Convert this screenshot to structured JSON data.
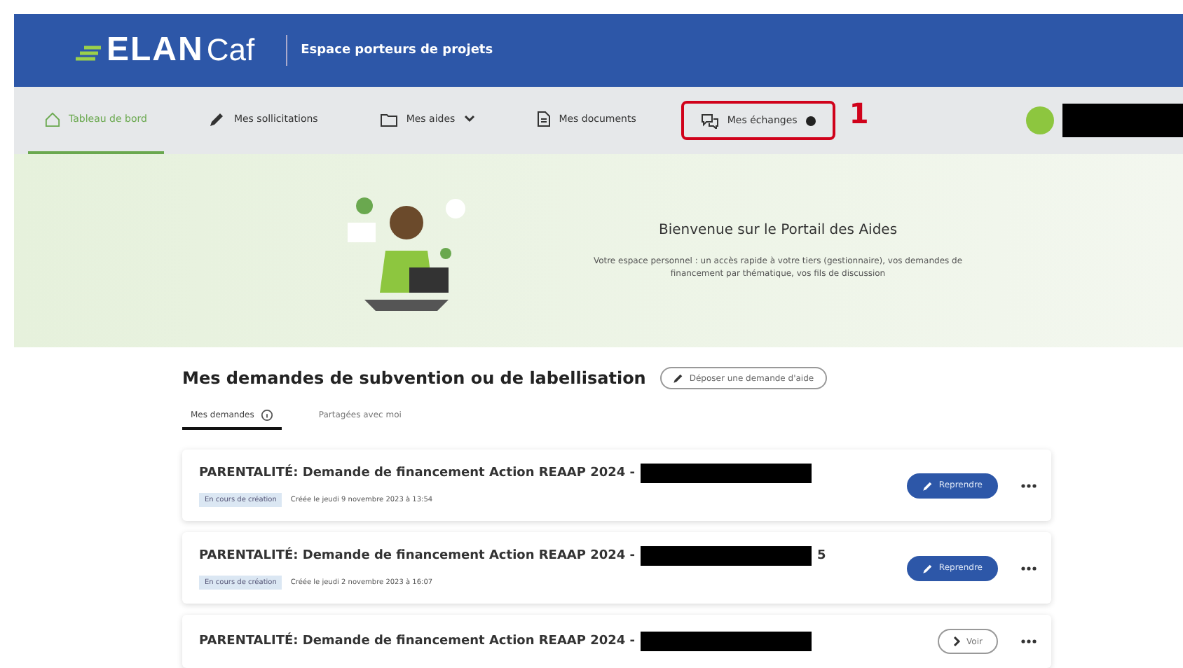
{
  "header": {
    "logo_bold": "ELAN",
    "logo_light": "Caf",
    "subtitle": "Espace porteurs de projets"
  },
  "nav": [
    {
      "label": "Tableau de bord",
      "selected": true,
      "dropdown": false,
      "badge": false,
      "highlighted": false
    },
    {
      "label": "Mes sollicitations",
      "selected": false,
      "dropdown": false,
      "badge": false,
      "highlighted": false
    },
    {
      "label": "Mes aides",
      "selected": false,
      "dropdown": true,
      "badge": false,
      "highlighted": false
    },
    {
      "label": "Mes documents",
      "selected": false,
      "dropdown": false,
      "badge": false,
      "highlighted": false
    },
    {
      "label": "Mes échanges",
      "selected": false,
      "dropdown": false,
      "badge": true,
      "highlighted": true
    }
  ],
  "annotation": "1",
  "hero": {
    "title": "Bienvenue sur le Portail des Aides",
    "text": "Votre espace personnel : un accès rapide à votre tiers (gestionnaire), vos demandes de financement par thématique, vos fils de discussion"
  },
  "section": {
    "title": "Mes demandes de subvention ou de labellisation",
    "action": "Déposer une demande d'aide"
  },
  "tabs": [
    {
      "label": "Mes demandes",
      "info": true,
      "selected": true
    },
    {
      "label": "Partagées avec moi",
      "info": false,
      "selected": false
    }
  ],
  "requests": [
    {
      "title": "PARENTALITÉ: Demande de financement Action REAAP 2024 -",
      "status": "En cours de création",
      "created": "Créée le jeudi 9 novembre 2023 à 13:54",
      "button": "Reprendre",
      "kind": "primary"
    },
    {
      "title": "PARENTALITÉ: Demande de financement Action REAAP 2024 -",
      "suffix": "5",
      "status": "En cours de création",
      "created": "Créée le jeudi 2 novembre 2023 à 16:07",
      "button": "Reprendre",
      "kind": "primary"
    },
    {
      "title": "PARENTALITÉ: Demande de financement Action REAAP 2024 -",
      "button": "Voir",
      "kind": "secondary"
    }
  ]
}
